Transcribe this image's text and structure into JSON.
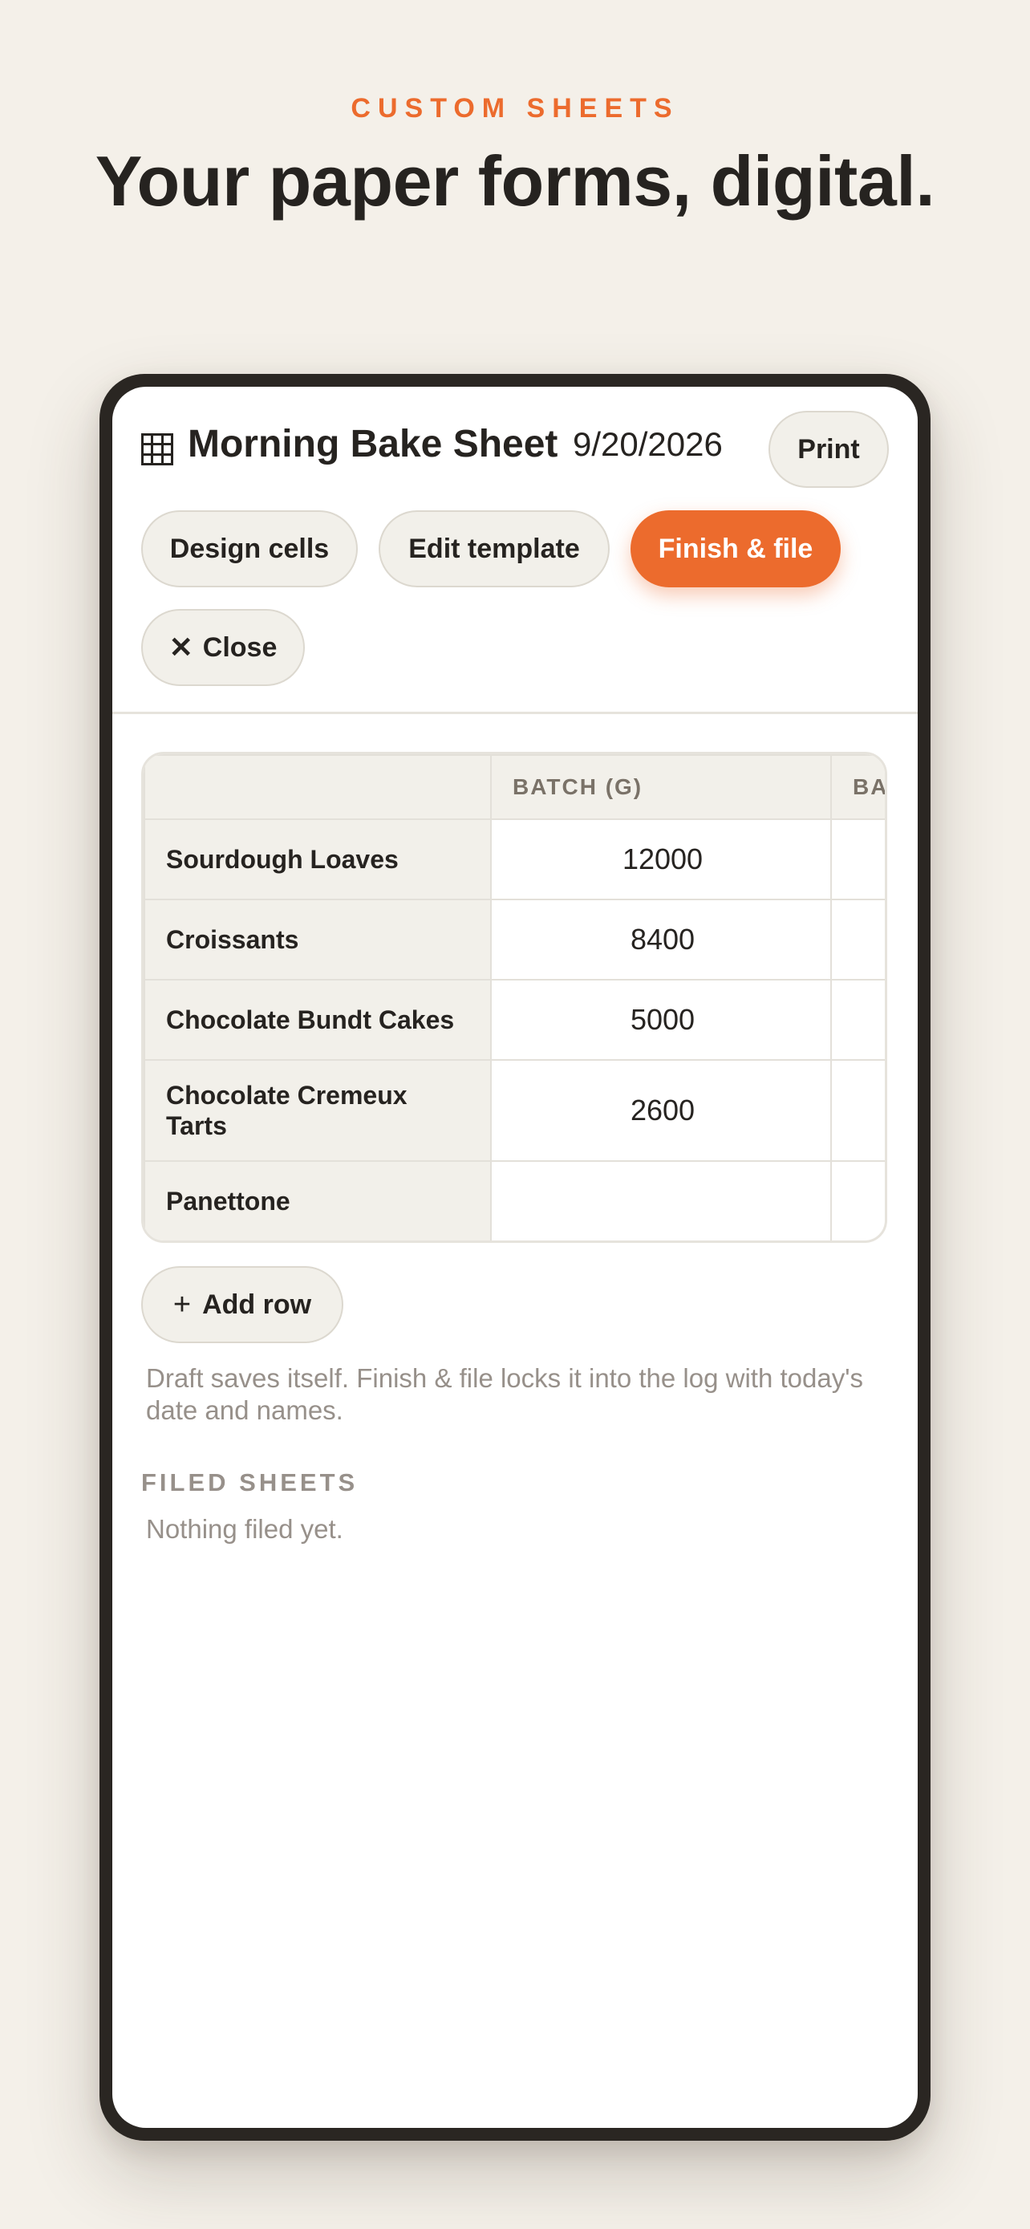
{
  "hero": {
    "eyebrow": "CUSTOM SHEETS",
    "headline": "Your paper forms, digital."
  },
  "sheet": {
    "icon": "grid-icon",
    "title": "Morning Bake Sheet",
    "date": "9/20/2026",
    "print_label": "Print",
    "actions": {
      "design": "Design cells",
      "edit": "Edit template",
      "finish": "Finish & file",
      "close_icon": "close-icon",
      "close": "Close"
    },
    "accent_color": "#ec6b2d"
  },
  "table": {
    "columns": [
      "",
      "BATCH (G)",
      "BA"
    ],
    "rows": [
      {
        "label": "Sourdough Loaves",
        "batch": "12000",
        "next": ""
      },
      {
        "label": "Croissants",
        "batch": "8400",
        "next": ""
      },
      {
        "label": "Chocolate Bundt Cakes",
        "batch": "5000",
        "next": ""
      },
      {
        "label": "Chocolate Cremeux Tarts",
        "batch": "2600",
        "next": ""
      },
      {
        "label": "Panettone",
        "batch": "",
        "next": ""
      }
    ]
  },
  "add_row": {
    "icon": "plus-icon",
    "label": "Add row"
  },
  "note": "Draft saves itself. Finish & file locks it into the log with today's date and names.",
  "filed": {
    "heading": "FILED SHEETS",
    "empty": "Nothing filed yet."
  }
}
